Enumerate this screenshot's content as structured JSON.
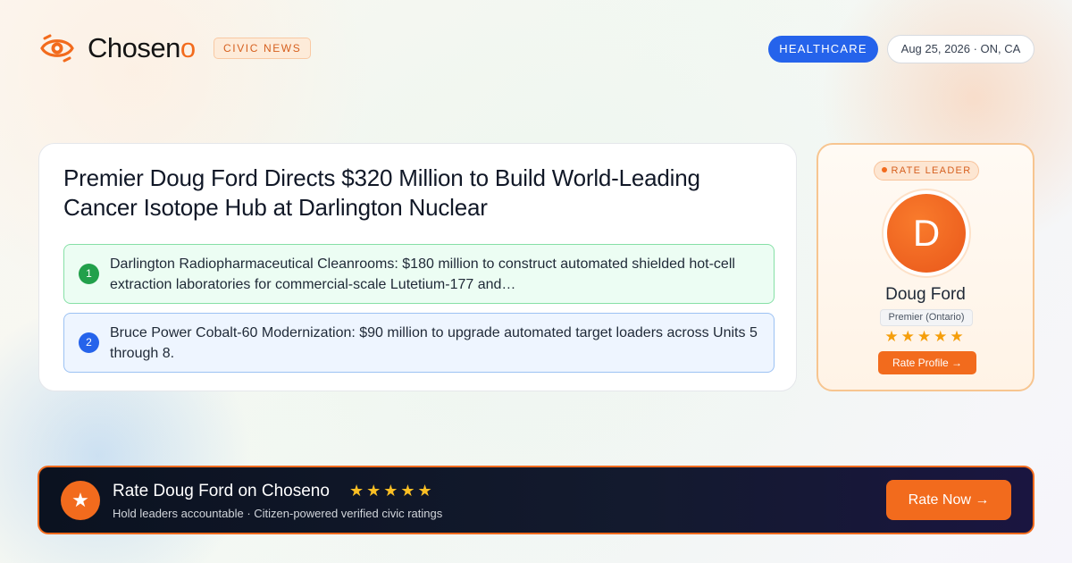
{
  "brand": {
    "name_main": "Chosen",
    "name_accent": "o",
    "tag": "CIVIC NEWS",
    "logo_icon": "eye-swirl-icon",
    "accent_color": "#f26b1d"
  },
  "header": {
    "category": "HEALTHCARE",
    "date_location": "Aug 25, 2026 · ON, CA"
  },
  "article": {
    "headline": "Premier Doug Ford Directs $320 Million to Build World-Leading Cancer Isotope Hub at Darlington Nuclear",
    "points": [
      {
        "number": "1",
        "text": "Darlington Radiopharmaceutical Cleanrooms: $180 million to construct automated shielded hot-cell extraction laboratories for commercial-scale Lutetium-177 and…"
      },
      {
        "number": "2",
        "text": "Bruce Power Cobalt-60 Modernization: $90 million to upgrade automated target loaders across Units 5 through 8."
      }
    ]
  },
  "leader": {
    "tag": "RATE LEADER",
    "initial": "D",
    "name": "Doug Ford",
    "role": "Premier (Ontario)",
    "stars_display": "★★★★★",
    "rating_stars": 5,
    "button_label": "Rate Profile →"
  },
  "banner": {
    "icon": "star-icon",
    "icon_glyph": "★",
    "title": "Rate Doug Ford on Choseno",
    "stars_display": "★★★★★",
    "subtitle": "Hold leaders accountable · Citizen-powered verified civic ratings",
    "button_label": "Rate Now →"
  }
}
